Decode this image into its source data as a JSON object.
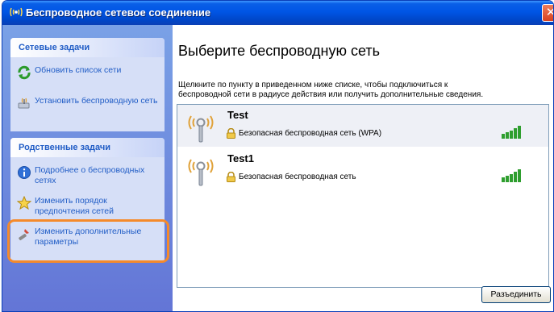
{
  "window": {
    "title": "Беспроводное сетевое соединение",
    "close_glyph": "✕"
  },
  "sidebar": {
    "network_tasks": {
      "title": "Сетевые задачи",
      "items": [
        {
          "label": "Обновить список сети",
          "icon": "refresh-icon"
        },
        {
          "label": "Установить беспроводную сеть",
          "icon": "setup-wizard-icon"
        }
      ]
    },
    "related_tasks": {
      "title": "Родственные задачи",
      "items": [
        {
          "label": "Подробнее о беспроводных сетях",
          "icon": "info-icon"
        },
        {
          "label": "Изменить порядок предпочтения сетей",
          "icon": "star-icon"
        },
        {
          "label": "Изменить дополнительные параметры",
          "icon": "tools-icon"
        }
      ]
    }
  },
  "main": {
    "heading": "Выберите беспроводную сеть",
    "description_line1": "Щелкните по пункту в приведенном ниже списке, чтобы подключиться к",
    "description_line2": "беспроводной сети в радиусе действия или получить дополнительные сведения.",
    "networks": [
      {
        "name": "Test",
        "status": "Безопасная беспроводная сеть (WPA)",
        "signal_bars": 5,
        "selected": true
      },
      {
        "name": "Test1",
        "status": "Безопасная беспроводная сеть",
        "signal_bars": 5,
        "selected": false
      }
    ],
    "disconnect_label": "Разъединить"
  },
  "colors": {
    "titlebar": "#0055e5",
    "sidebar_link": "#215dc6",
    "highlight_ring": "#f58a2b",
    "signal_green": "#2e9e2e"
  }
}
